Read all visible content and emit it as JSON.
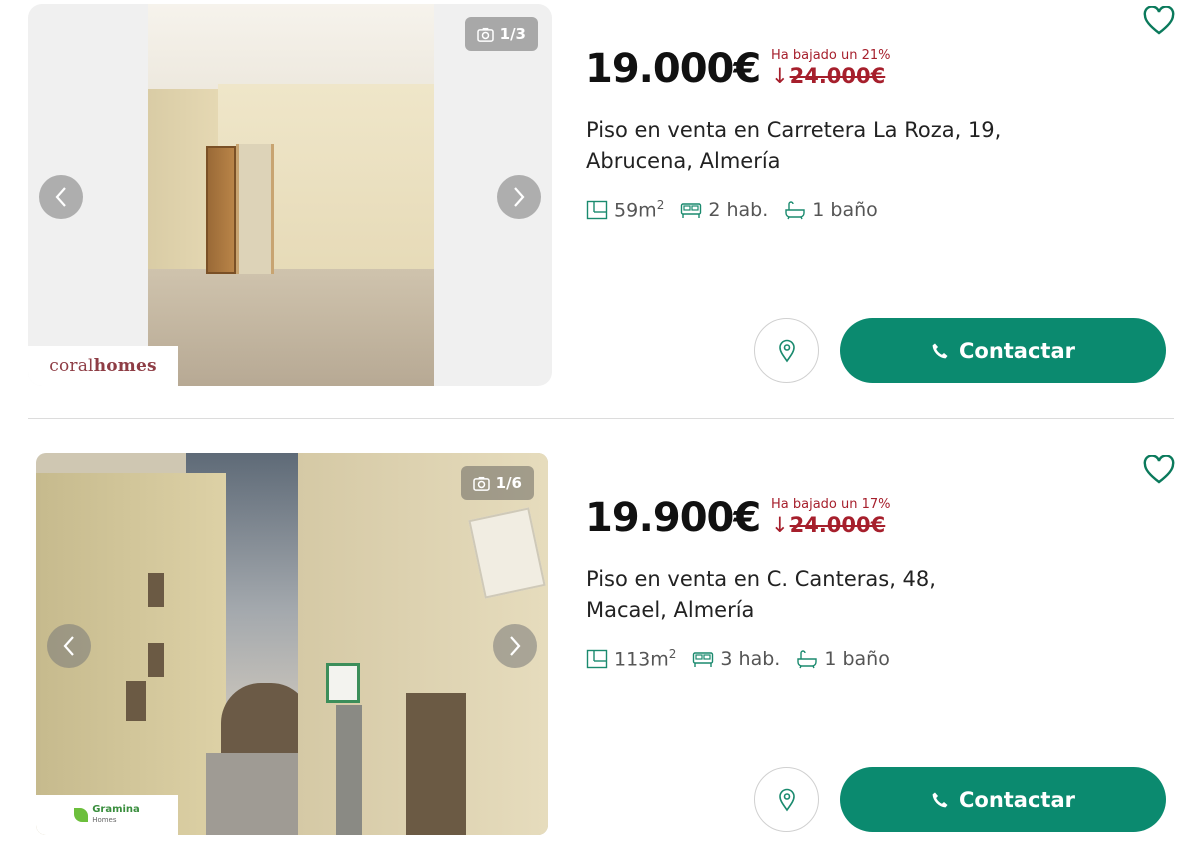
{
  "colors": {
    "accent": "#0b8a6f",
    "price_drop": "#a61f2c",
    "heart": "#0b7a5c",
    "feature_icon": "#1a8a6e"
  },
  "listings": [
    {
      "photo_counter": "1/3",
      "agency": {
        "name_light": "coral",
        "name_bold": "homes"
      },
      "price": "19.000€",
      "price_drop_label": "Ha bajado un 21%",
      "old_price_arrow": "↓",
      "old_price": "24.000€",
      "title": "Piso en venta en Carretera La Roza, 19, Abrucena, Almería",
      "features": {
        "area": "59m",
        "area_unit": "2",
        "rooms": "2 hab.",
        "baths": "1 baño"
      },
      "contact_label": "Contactar"
    },
    {
      "photo_counter": "1/6",
      "agency": {
        "name": "Gramina",
        "subtitle": "Homes"
      },
      "price": "19.900€",
      "price_drop_label": "Ha bajado un 17%",
      "old_price_arrow": "↓",
      "old_price": "24.000€",
      "title": "Piso en venta en C. Canteras, 48, Macael, Almería",
      "features": {
        "area": "113m",
        "area_unit": "2",
        "rooms": "3 hab.",
        "baths": "1 baño"
      },
      "contact_label": "Contactar"
    }
  ]
}
